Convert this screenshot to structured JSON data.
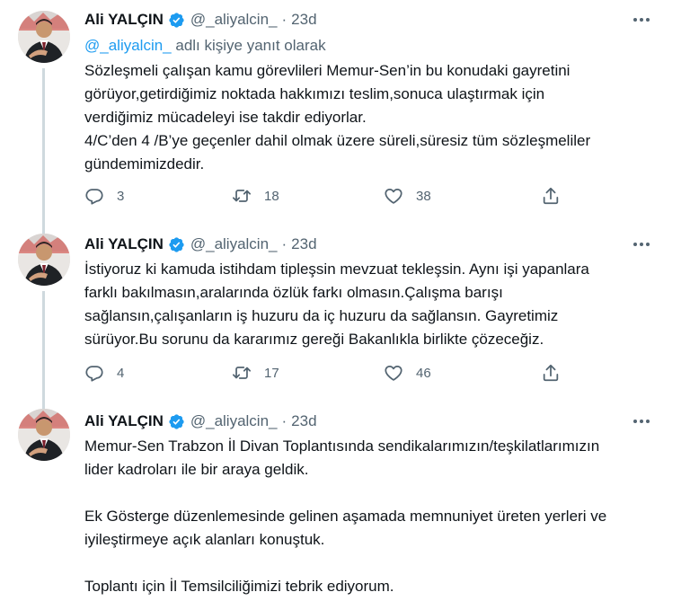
{
  "tweets": [
    {
      "author": {
        "name": "Ali YALÇIN",
        "handle": "@_aliyalcin_"
      },
      "separator": "·",
      "time": "23d",
      "reply_to": {
        "mention": "@_aliyalcin_",
        "suffix": " adlı kişiye yanıt olarak"
      },
      "lines": [
        "Sözleşmeli çalışan kamu görevlileri Memur-Sen’in bu konudaki gayretini",
        "görüyor,getirdiğimiz noktada hakkımızı teslim,sonuca ulaştırmak için",
        "verdiğimiz mücadeleyi ise takdir ediyorlar.",
        "4/C’den 4 /B’ye geçenler dahil olmak üzere süreli,süresiz tüm sözleşmeliler",
        "gündemimizdedir."
      ],
      "stats": {
        "replies": "3",
        "retweets": "18",
        "likes": "38"
      }
    },
    {
      "author": {
        "name": "Ali YALÇIN",
        "handle": "@_aliyalcin_"
      },
      "separator": "·",
      "time": "23d",
      "lines": [
        "İstiyoruz ki kamuda istihdam tipleşsin mevzuat tekleşsin. Aynı işi yapanlara",
        "farklı bakılmasın,aralarında özlük farkı olmasın.Çalışma barışı",
        "sağlansın,çalışanların iş huzuru da iç huzuru da sağlansın. Gayretimiz",
        "sürüyor.Bu sorunu da kararımız gereği Bakanlıkla birlikte çözeceğiz."
      ],
      "stats": {
        "replies": "4",
        "retweets": "17",
        "likes": "46"
      }
    },
    {
      "author": {
        "name": "Ali YALÇIN",
        "handle": "@_aliyalcin_"
      },
      "separator": "·",
      "time": "23d",
      "paragraph1": [
        "Memur-Sen Trabzon İl Divan Toplantısında sendikalarımızın/teşkilatlarımızın",
        "lider kadroları ile bir araya geldik."
      ],
      "paragraph2": [
        "Ek Gösterge düzenlemesinde gelinen aşamada memnuniyet üreten yerleri ve",
        "iyileştirmeye açık alanları konuştuk."
      ],
      "paragraph3": [
        "Toplantı için İl Temsilciliğimizi tebrik ediyorum."
      ]
    }
  ],
  "icons": {
    "verified": "verified-badge-icon",
    "reply": "reply-icon",
    "retweet": "retweet-icon",
    "like": "heart-icon",
    "share": "share-icon",
    "more": "more-icon"
  },
  "colors": {
    "accent": "#1d9bf0",
    "secondary_text": "#536471",
    "thread_line": "#cfd9de"
  }
}
